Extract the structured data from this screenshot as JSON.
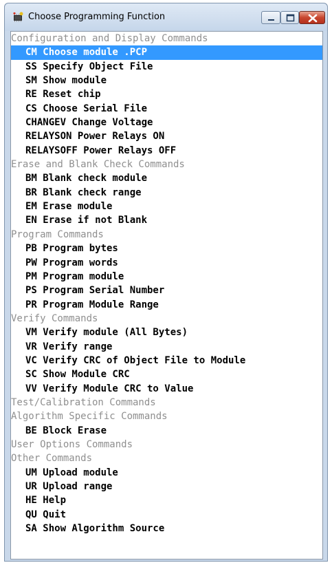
{
  "window": {
    "title": "Choose Programming Function",
    "icon": "chip-app-icon"
  },
  "list": {
    "items": [
      {
        "text": "Configuration and Display Commands",
        "kind": "header"
      },
      {
        "text": "CM Choose module .PCP",
        "kind": "command",
        "selected": true
      },
      {
        "text": "SS Specify Object File",
        "kind": "command"
      },
      {
        "text": "SM Show module",
        "kind": "command"
      },
      {
        "text": "RE Reset chip",
        "kind": "command"
      },
      {
        "text": "CS Choose Serial File",
        "kind": "command"
      },
      {
        "text": "CHANGEV Change Voltage",
        "kind": "command"
      },
      {
        "text": "RELAYSON Power Relays ON",
        "kind": "command"
      },
      {
        "text": "RELAYSOFF Power Relays OFF",
        "kind": "command"
      },
      {
        "text": "Erase and Blank Check Commands",
        "kind": "header"
      },
      {
        "text": "BM Blank check module",
        "kind": "command"
      },
      {
        "text": "BR Blank check range",
        "kind": "command"
      },
      {
        "text": "EM Erase module",
        "kind": "command"
      },
      {
        "text": "EN Erase if not Blank",
        "kind": "command"
      },
      {
        "text": "Program Commands",
        "kind": "header"
      },
      {
        "text": "PB Program bytes",
        "kind": "command"
      },
      {
        "text": "PW Program words",
        "kind": "command"
      },
      {
        "text": "PM Program module",
        "kind": "command"
      },
      {
        "text": "PS Program Serial Number",
        "kind": "command"
      },
      {
        "text": "PR Program Module Range",
        "kind": "command"
      },
      {
        "text": "Verify Commands",
        "kind": "header"
      },
      {
        "text": "VM Verify module (All Bytes)",
        "kind": "command"
      },
      {
        "text": "VR Verify range",
        "kind": "command"
      },
      {
        "text": "VC Verify CRC of Object File to Module",
        "kind": "command"
      },
      {
        "text": "SC Show Module CRC",
        "kind": "command"
      },
      {
        "text": "VV Verify Module CRC to Value",
        "kind": "command"
      },
      {
        "text": "Test/Calibration Commands",
        "kind": "header"
      },
      {
        "text": "Algorithm Specific Commands",
        "kind": "header"
      },
      {
        "text": "BE Block Erase",
        "kind": "command"
      },
      {
        "text": "User Options Commands",
        "kind": "header"
      },
      {
        "text": "Other Commands",
        "kind": "header"
      },
      {
        "text": "UM Upload module",
        "kind": "command"
      },
      {
        "text": "UR Upload range",
        "kind": "command"
      },
      {
        "text": "HE Help",
        "kind": "command"
      },
      {
        "text": "QU Quit",
        "kind": "command"
      },
      {
        "text": "SA Show Algorithm Source",
        "kind": "command"
      }
    ]
  },
  "colors": {
    "selection": "#3399ff",
    "header_text": "#8f8f8f"
  }
}
